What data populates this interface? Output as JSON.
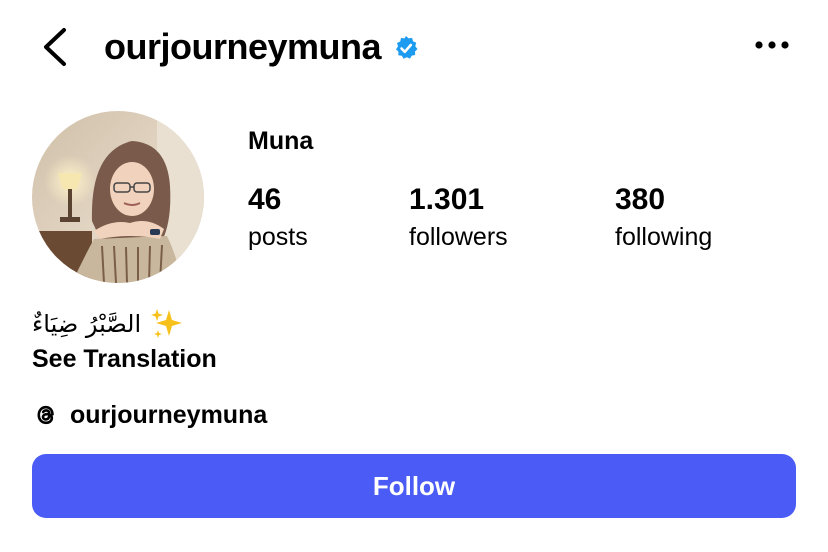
{
  "header": {
    "username": "ourjourneymuna",
    "back_icon": "chevron-left-icon",
    "verified_icon": "verified-badge-icon",
    "more_icon": "more-horizontal-icon"
  },
  "profile": {
    "display_name": "Muna",
    "avatar_alt": "profile photo",
    "stats": [
      {
        "count": "46",
        "label": "posts"
      },
      {
        "count": "1.301",
        "label": "followers"
      },
      {
        "count": "380",
        "label": "following"
      }
    ],
    "bio_text": "الصَّبْرُ ضِيَاءٌ",
    "bio_emoji": "sparkles-icon",
    "see_translation": "See Translation",
    "threads_handle": "ourjourneymuna",
    "threads_icon": "threads-icon"
  },
  "actions": {
    "follow_label": "Follow"
  },
  "colors": {
    "follow_button": "#4a5cf5",
    "verified": "#1d9bf0",
    "sparkle": "#f7c11c"
  }
}
